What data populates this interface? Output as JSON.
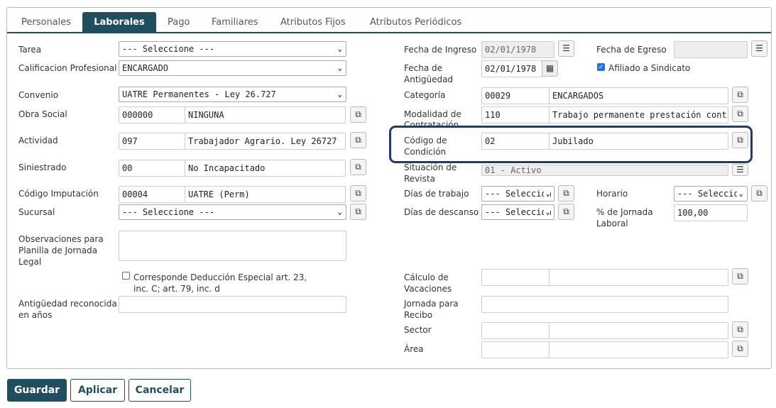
{
  "tabs": [
    "Personales",
    "Laborales",
    "Pago",
    "Familiares",
    "Atributos Fijos",
    "Atributos Periódicos"
  ],
  "left": {
    "tarea": {
      "label": "Tarea",
      "value": "--- Seleccione ---"
    },
    "calificacion": {
      "label": "Calificacion Profesional",
      "value": "ENCARGADO"
    },
    "convenio": {
      "label": "Convenio",
      "value": "UATRE Permanentes - Ley 26.727"
    },
    "obra_social": {
      "label": "Obra Social",
      "code": "000000",
      "desc": "NINGUNA"
    },
    "actividad": {
      "label": "Actividad",
      "code": "097",
      "desc": "Trabajador Agrario. Ley 26727"
    },
    "siniestrado": {
      "label": "Siniestrado",
      "code": "00",
      "desc": "No Incapacitado"
    },
    "codigo_imputacion": {
      "label": "Código Imputación",
      "code": "00004",
      "desc": "UATRE (Perm)"
    },
    "sucursal": {
      "label": "Sucursal",
      "value": "--- Seleccione ---"
    },
    "observaciones": {
      "label_1": "Observaciones para",
      "label_2": "Planilla de Jornada",
      "label_3": "Legal"
    },
    "deduccion": {
      "line_1": "Corresponde Deducción Especial art. 23,",
      "line_2": "inc. C; art. 79, inc. d"
    },
    "antiguedad_reconocida": {
      "label_1": "Antigüedad reconocida",
      "label_2": "en años",
      "value": ""
    }
  },
  "right": {
    "fecha_ingreso": {
      "label": "Fecha de Ingreso",
      "value": "02/01/1978"
    },
    "fecha_egreso": {
      "label": "Fecha de Egreso",
      "value": ""
    },
    "fecha_antiguedad": {
      "label_1": "Fecha de",
      "label_2": "Antigüedad",
      "value": "02/01/1978"
    },
    "afiliado": {
      "label": "Afiliado a Sindicato"
    },
    "categoria": {
      "label": "Categoría",
      "code": "00029",
      "desc": "ENCARGADOS"
    },
    "modalidad": {
      "label_1": "Modalidad de",
      "label_2": "Contratación",
      "code": "110",
      "desc": "Trabajo permanente prestación continua Le"
    },
    "codigo_condicion": {
      "label_1": "Código de",
      "label_2": "Condición",
      "code": "02",
      "desc": "Jubilado"
    },
    "situacion_revista": {
      "label_1": "Situación de",
      "label_2": "Revista",
      "value": "01 - Activo"
    },
    "dias_trabajo": {
      "label": "Días de trabajo",
      "value": "--- Seleccion"
    },
    "horario": {
      "label": "Horario",
      "value": "--- Seleccion"
    },
    "dias_descanso": {
      "label": "Días de descanso",
      "value": "--- Seleccion"
    },
    "pct_jornada": {
      "label_1": "% de Jornada",
      "label_2": "Laboral",
      "value": "100,00"
    },
    "calculo_vacaciones": {
      "label_1": "Cálculo de",
      "label_2": "Vacaciones"
    },
    "jornada_recibo": {
      "label_1": "Jornada para",
      "label_2": "Recibo"
    },
    "sector": {
      "label": "Sector"
    },
    "area": {
      "label": "Área"
    }
  },
  "actions": {
    "save": "Guardar",
    "apply": "Aplicar",
    "cancel": "Cancelar"
  }
}
